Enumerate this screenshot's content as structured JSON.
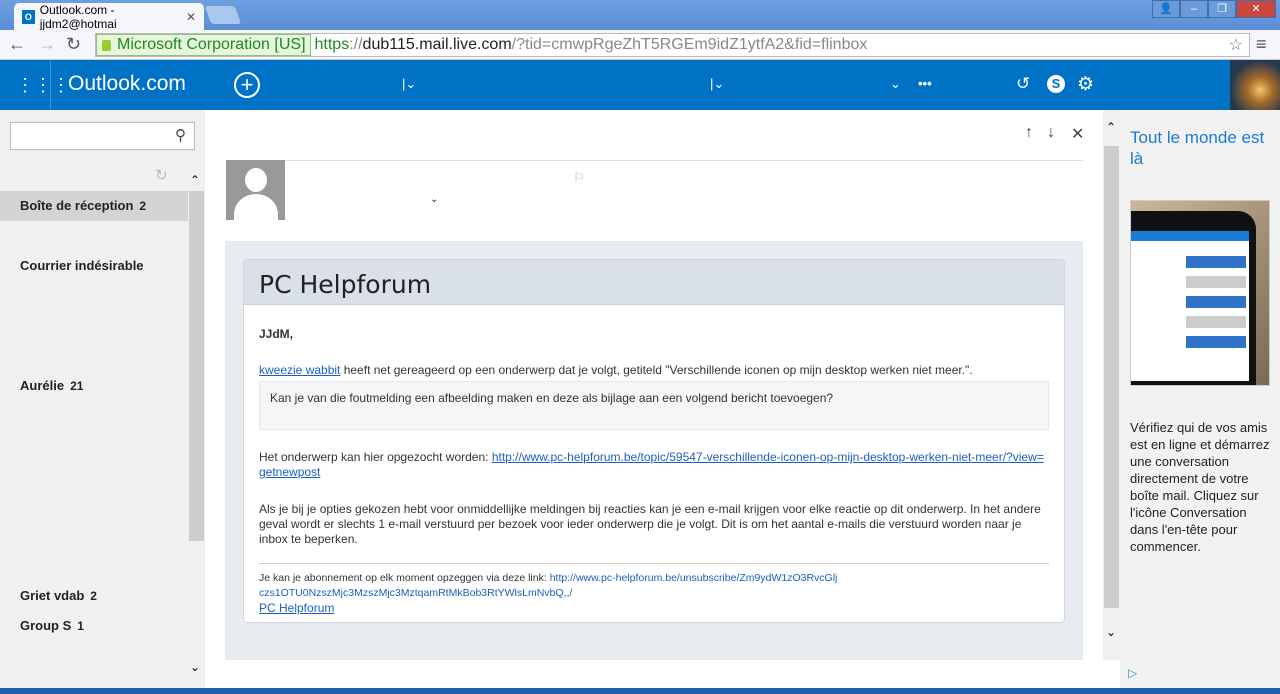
{
  "browser": {
    "tab_title": "Outlook.com - jjdm2@hotmai",
    "ev_label": "Microsoft Corporation [US]",
    "url_scheme": "https",
    "url_sep": "://",
    "url_host": "dub115.mail.live.com",
    "url_rest": "/?tid=cmwpRgeZhT5RGEm9idZ1ytfA2&fid=flinbox"
  },
  "header": {
    "brand": "Outlook.com"
  },
  "sidebar": {
    "search_placeholder": "",
    "folders": [
      {
        "label": "Boîte de réception",
        "count": "2"
      },
      {
        "label": "Courrier indésirable",
        "count": ""
      },
      {
        "label": "Aurélie",
        "count": "21"
      },
      {
        "label": "Griet vdab",
        "count": "2"
      },
      {
        "label": "Group S",
        "count": "1"
      }
    ]
  },
  "email": {
    "title": "PC Helpforum",
    "greeting": "JJdM,",
    "author_link": "kweezie wabbit",
    "intro": " heeft net gereageerd op een onderwerp dat je volgt, getiteld \"Verschillende iconen op mijn desktop werken niet meer.\".",
    "quote": "Kan je van die foutmelding een afbeelding maken en deze als bijlage aan een volgend bericht toevoegen?",
    "topic_text": "Het onderwerp kan hier opgezocht worden: ",
    "topic_link": "http://www.pc-helpforum.be/topic/59547-verschillende-iconen-op-mijn-desktop-werken-niet-meer/?view=getnewpost",
    "notice": "Als je bij je opties gekozen hebt voor onmiddellijke meldingen bij reacties kan je een e-mail krijgen voor elke reactie op dit onderwerp. In het andere geval wordt er slechts 1 e-mail verstuurd per bezoek voor ieder onderwerp die je volgt. Dit is om het aantal e-mails die verstuurd worden naar je inbox te beperken.",
    "unsub_text": "Je kan je abonnement op elk moment opzeggen via deze link: ",
    "unsub_link": "http://www.pc-helpforum.be/unsubscribe/Zm9ydW1zO3RvcGljczs1OTU0NzszMjc3MzszMjc3MztqamRtMkBob3RtYWlsLmNvbQ,,/",
    "footer_link": "PC Helpforum"
  },
  "ad": {
    "title": "Tout le monde est là",
    "body": "Vérifiez qui de vos amis est en ligne et démarrez une conversation directement de votre boîte mail. Cliquez sur l'icône Conversation dans l'en-tête pour commencer."
  }
}
